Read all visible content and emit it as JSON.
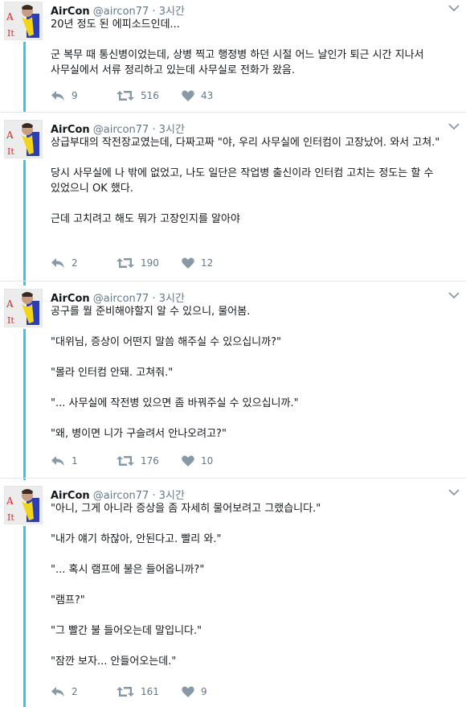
{
  "tweets": [
    {
      "name": "AirCon",
      "handle": "@aircon77",
      "time": "3시간",
      "text": "20년 정도 된 에피소드인데...\n\n군 복무 때 통신병이었는데, 상병 찍고 행정병 하던 시절 어느 날인가 퇴근 시간 지나서 사무실에서 서류 정리하고 있는데 사무실로 전화가 왔음.",
      "replies": "9",
      "retweets": "516",
      "likes": "43"
    },
    {
      "name": "AirCon",
      "handle": "@aircon77",
      "time": "3시간",
      "text": "상급부대의 작전장교였는데, 다짜고짜 \"야, 우리 사무실에 인터컴이 고장났어. 와서 고쳐.\"\n\n당시 사무실에 나 밖에 없었고, 나도 일단은 작업병 출신이라 인터컴 고치는 정도는 할 수 있었으니 OK 했다.\n\n근데 고치려고 해도 뭐가 고장인지를 알아야",
      "replies": "2",
      "retweets": "190",
      "likes": "12"
    },
    {
      "name": "AirCon",
      "handle": "@aircon77",
      "time": "3시간",
      "text": "공구를 뭘 준비해야할지 알 수 있으니, 물어봄.\n\n\"대위님, 증상이 어떤지 말씀 해주실 수 있으십니까?\"\n\n\"몰라 인터컴 안돼. 고쳐줘.\"\n\n\"... 사무실에 작전병 있으면 좀 바꿔주실 수 있으십니까.\"\n\n\"왜, 병이면 니가 구슬려서 안나오려고?\"",
      "replies": "1",
      "retweets": "176",
      "likes": "10"
    },
    {
      "name": "AirCon",
      "handle": "@aircon77",
      "time": "3시간",
      "text": "\"아니, 그게 아니라 증상을 좀 자세히 물어보려고 그랬습니다.\"\n\n\"내가 얘기 하잖아, 안된다고. 빨리 와.\"\n\n\"... 혹시 램프에 불은 들어옵니까?\"\n\n\"램프?\"\n\n\"그 빨간 불 들어오는데 말입니다.\"\n\n\"잠깐 보자... 안들어오는데.\"",
      "replies": "2",
      "retweets": "161",
      "likes": "9"
    }
  ],
  "colors": {
    "thread_line": "#34c7e8",
    "meta_text": "#657786",
    "main_text": "#14171a"
  },
  "icons": [
    "reply-icon",
    "retweet-icon",
    "like-icon",
    "chevron-down-icon"
  ]
}
